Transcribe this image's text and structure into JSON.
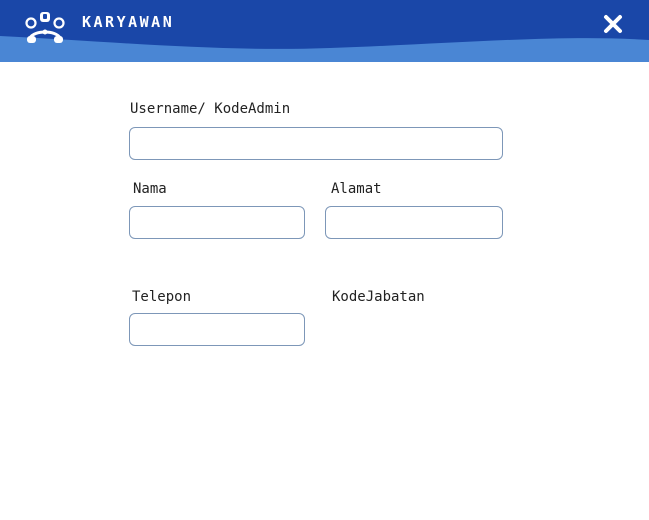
{
  "header": {
    "title": "KARYAWAN",
    "bg_color": "#1a47a8",
    "wave_color": "#4a86d4",
    "logo_icon": "robot-logo-icon",
    "close_icon": "close-icon"
  },
  "form": {
    "username": {
      "label": "Username/ KodeAdmin",
      "value": "",
      "placeholder": ""
    },
    "nama": {
      "label": "Nama",
      "value": "",
      "placeholder": ""
    },
    "alamat": {
      "label": "Alamat",
      "value": "",
      "placeholder": ""
    },
    "telepon": {
      "label": "Telepon",
      "value": "",
      "placeholder": ""
    },
    "kode_jabatan": {
      "label": "KodeJabatan"
    }
  }
}
